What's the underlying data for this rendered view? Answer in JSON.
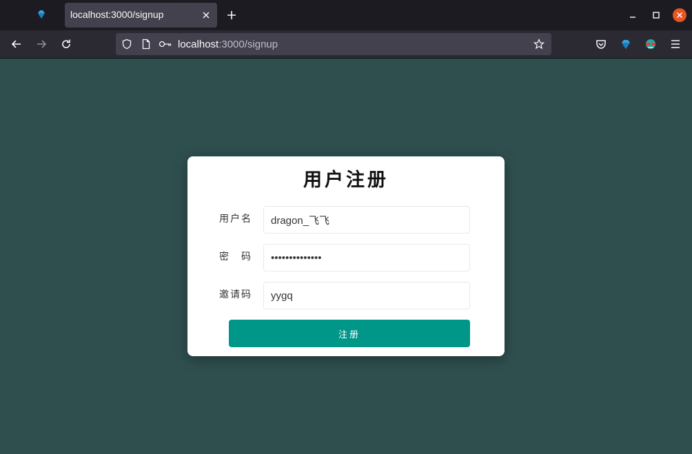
{
  "browser": {
    "tab_title": "localhost:3000/signup",
    "url_host": "localhost",
    "url_rest": ":3000/signup"
  },
  "signup": {
    "title": "用户注册",
    "username_label": "用户名",
    "username_value": "dragon_飞飞",
    "password_label": "密　码",
    "password_value": "yygqyygqyygqyy",
    "invite_label": "邀请码",
    "invite_value": "yygq",
    "submit_label": "注册"
  },
  "colors": {
    "page_background": "#2f4f4f",
    "button": "#009688"
  }
}
